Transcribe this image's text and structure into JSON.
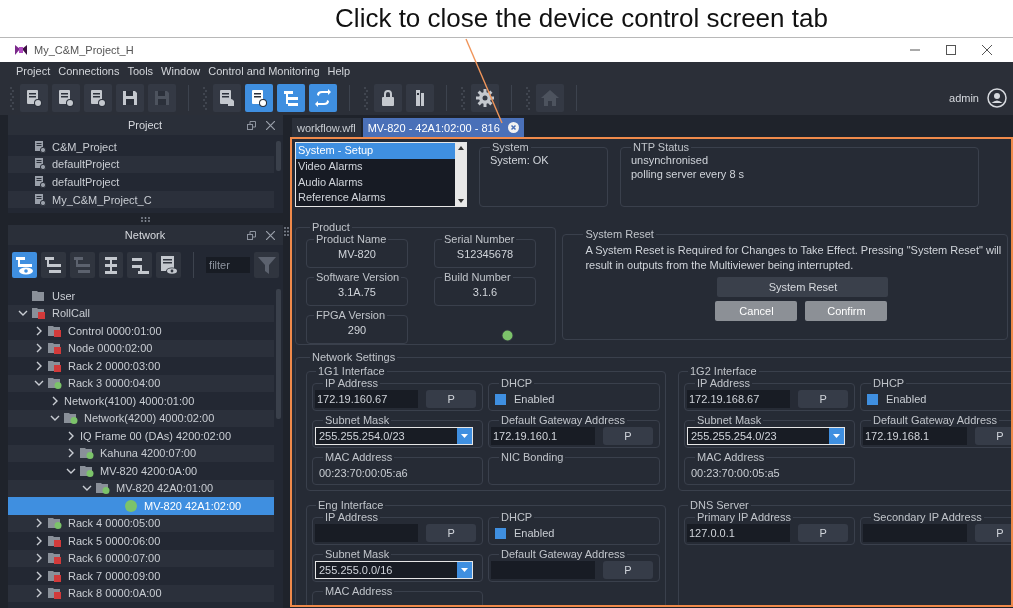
{
  "annotation": {
    "text": "Click to close the device control screen tab"
  },
  "window": {
    "title": "My_C&M_Project_H"
  },
  "menu": [
    "Project",
    "Connections",
    "Tools",
    "Window",
    "Control and Monitoring",
    "Help"
  ],
  "toolbar": [
    {
      "buttons": [
        {
          "kind": "doc-add",
          "selected": false,
          "disabled": false
        },
        {
          "kind": "doc-down",
          "selected": false,
          "disabled": false
        },
        {
          "kind": "doc-up",
          "selected": false,
          "disabled": false
        },
        {
          "kind": "save",
          "selected": false,
          "disabled": false
        },
        {
          "kind": "save-add",
          "selected": false,
          "disabled": true
        }
      ]
    },
    {
      "buttons": [
        {
          "kind": "doc-bell",
          "selected": false,
          "disabled": false
        },
        {
          "kind": "doc-info",
          "selected": true,
          "disabled": false
        },
        {
          "kind": "tree",
          "selected": true,
          "disabled": false
        },
        {
          "kind": "sync",
          "selected": true,
          "disabled": false
        }
      ]
    },
    {
      "buttons": [
        {
          "kind": "lock",
          "selected": false,
          "disabled": false
        },
        {
          "kind": "meter",
          "selected": false,
          "disabled": false
        }
      ]
    },
    {
      "buttons": [
        {
          "kind": "gear",
          "selected": false,
          "disabled": false
        }
      ]
    },
    {
      "buttons": [
        {
          "kind": "home",
          "selected": false,
          "disabled": true
        }
      ]
    }
  ],
  "user": "admin",
  "project_panel": {
    "title": "Project",
    "items": [
      "C&M_Project",
      "defaultProject",
      "defaultProject",
      "My_C&M_Project_C"
    ]
  },
  "network_panel": {
    "title": "Network",
    "tools": [
      {
        "kind": "tree-eye",
        "selected": true,
        "disabled": false
      },
      {
        "kind": "tree",
        "selected": false,
        "disabled": false
      },
      {
        "kind": "tree",
        "selected": false,
        "disabled": true
      },
      {
        "kind": "tree-center",
        "selected": false,
        "disabled": false
      },
      {
        "kind": "tree-end",
        "selected": false,
        "disabled": false
      },
      {
        "kind": "list-eye",
        "selected": false,
        "disabled": false
      }
    ],
    "filter": {
      "placeholder": "filter"
    }
  },
  "tree": [
    {
      "label": "User",
      "kind": "folder",
      "selected": false
    },
    {
      "label": "RollCall",
      "kind": "folder",
      "color": "#d23a3a",
      "expanded": true,
      "selected": false,
      "children": [
        {
          "label": "Control 0000:01:00",
          "kind": "folder",
          "color": "#d23a3a",
          "expanded": false,
          "selected": false
        },
        {
          "label": "Node 0000:02:00",
          "kind": "folder",
          "color": "#d23a3a",
          "expanded": false,
          "selected": false
        },
        {
          "label": "Rack 2 0000:03:00",
          "kind": "folder",
          "color": "#d23a3a",
          "expanded": false,
          "selected": false
        },
        {
          "label": "Rack 3 0000:04:00",
          "kind": "folder",
          "color": "#7cc36a",
          "expanded": true,
          "selected": false,
          "children": [
            {
              "label": "Network(4100) 4000:01:00",
              "kind": "plain",
              "expanded": false,
              "selected": false
            },
            {
              "label": "Network(4200) 4000:02:00",
              "kind": "folder",
              "color": "#7cc36a",
              "expanded": true,
              "selected": false,
              "children": [
                {
                  "label": "IQ Frame 00 (DAs) 4200:02:00",
                  "kind": "plain",
                  "expanded": false,
                  "selected": false
                },
                {
                  "label": "Kahuna 4200:07:00",
                  "kind": "folder",
                  "color": "#7cc36a",
                  "expanded": false,
                  "selected": false
                },
                {
                  "label": "MV-820 4200:0A:00",
                  "kind": "folder",
                  "color": "#7cc36a",
                  "expanded": true,
                  "selected": false,
                  "children": [
                    {
                      "label": "MV-820 42A0:01:00",
                      "kind": "folder",
                      "color": "#7cc36a",
                      "expanded": true,
                      "selected": false,
                      "children": [
                        {
                          "label": "MV-820 42A1:02:00",
                          "kind": "dot",
                          "color": "#7cc36a",
                          "selected": true
                        }
                      ]
                    }
                  ]
                }
              ]
            }
          ]
        },
        {
          "label": "Rack 4 0000:05:00",
          "kind": "folder",
          "color": "#7cc36a",
          "expanded": false,
          "selected": false
        },
        {
          "label": "Rack 5 0000:06:00",
          "kind": "folder",
          "color": "#d23a3a",
          "expanded": false,
          "selected": false
        },
        {
          "label": "Rack 6 0000:07:00",
          "kind": "folder",
          "color": "#d23a3a",
          "expanded": false,
          "selected": false
        },
        {
          "label": "Rack 7 0000:09:00",
          "kind": "folder",
          "color": "#d23a3a",
          "expanded": false,
          "selected": false
        },
        {
          "label": "Rack 8 0000:0A:00",
          "kind": "folder",
          "color": "#d23a3a",
          "expanded": false,
          "selected": false
        }
      ]
    }
  ],
  "tabs": [
    {
      "label": "workflow.wfl",
      "selected": false,
      "closable": false
    },
    {
      "label": "MV-820 - 42A1:02:00 - 816",
      "selected": true,
      "closable": true
    }
  ],
  "device": {
    "sections": [
      {
        "label": "System - Setup",
        "selected": true
      },
      {
        "label": "Video Alarms",
        "selected": false
      },
      {
        "label": "Audio Alarms",
        "selected": false
      },
      {
        "label": "Reference Alarms",
        "selected": false
      }
    ],
    "system": {
      "title": "System",
      "status": "System: OK"
    },
    "ntp": {
      "title": "NTP Status",
      "lines": [
        "unsynchronised",
        "polling server every 8 s"
      ]
    },
    "product": {
      "title": "Product",
      "fields": [
        {
          "label": "Product Name",
          "value": "MV-820"
        },
        {
          "label": "Serial Number",
          "value": "S12345678"
        },
        {
          "label": "Software Version",
          "value": "3.1A.75"
        },
        {
          "label": "Build Number",
          "value": "3.1.6"
        },
        {
          "label": "FPGA Version",
          "value": "290"
        }
      ],
      "status_light": {
        "color": "#7cc36a"
      }
    },
    "reset": {
      "title": "System Reset",
      "message": "A System Reset is Required for Changes to Take Effect. Pressing \"System Reset\" will result in outputs from the Multiviewer being interrupted.",
      "buttons": [
        "System Reset",
        "Cancel",
        "Confirm"
      ]
    },
    "network": {
      "title": "Network Settings",
      "groups": [
        {
          "title": "1G1 Interface",
          "boxes": [
            {
              "kind": "address",
              "label": "IP Address",
              "value": "172.19.160.67",
              "button": "P"
            },
            {
              "kind": "checkbox",
              "label": "DHCP",
              "option": "Enabled",
              "checked": true
            },
            {
              "kind": "dropdown",
              "label": "Subnet Mask",
              "value": "255.255.254.0/23"
            },
            {
              "kind": "address",
              "label": "Default Gateway Address",
              "value": "172.19.160.1",
              "button": "P"
            },
            {
              "kind": "text",
              "label": "MAC Address",
              "value": "00:23:70:00:05:a6"
            },
            {
              "kind": "text",
              "label": "NIC Bonding"
            }
          ]
        },
        {
          "title": "1G2 Interface",
          "boxes": [
            {
              "kind": "address",
              "label": "IP Address",
              "value": "172.19.168.67",
              "button": "P"
            },
            {
              "kind": "checkbox",
              "label": "DHCP",
              "option": "Enabled",
              "checked": true
            },
            {
              "kind": "dropdown",
              "label": "Subnet Mask",
              "value": "255.255.254.0/23"
            },
            {
              "kind": "address",
              "label": "Default Gateway Address",
              "value": "172.19.168.1",
              "button": "P"
            },
            {
              "kind": "text",
              "label": "MAC Address",
              "value": "00:23:70:00:05:a5"
            }
          ]
        },
        {
          "title": "Eng Interface",
          "boxes": [
            {
              "kind": "address",
              "label": "IP Address",
              "button": "P"
            },
            {
              "kind": "checkbox",
              "label": "DHCP",
              "option": "Enabled",
              "checked": true
            },
            {
              "kind": "dropdown",
              "label": "Subnet Mask",
              "value": "255.255.0.0/16"
            },
            {
              "kind": "address",
              "label": "Default Gateway Address",
              "button": "P"
            },
            {
              "kind": "text",
              "label": "MAC Address"
            }
          ]
        },
        {
          "title": "DNS Server",
          "boxes": [
            {
              "kind": "address",
              "label": "Primary IP Address",
              "value": "127.0.0.1",
              "button": "P"
            },
            {
              "kind": "address",
              "label": "Secondary IP Address",
              "button": "P"
            }
          ]
        }
      ]
    }
  }
}
